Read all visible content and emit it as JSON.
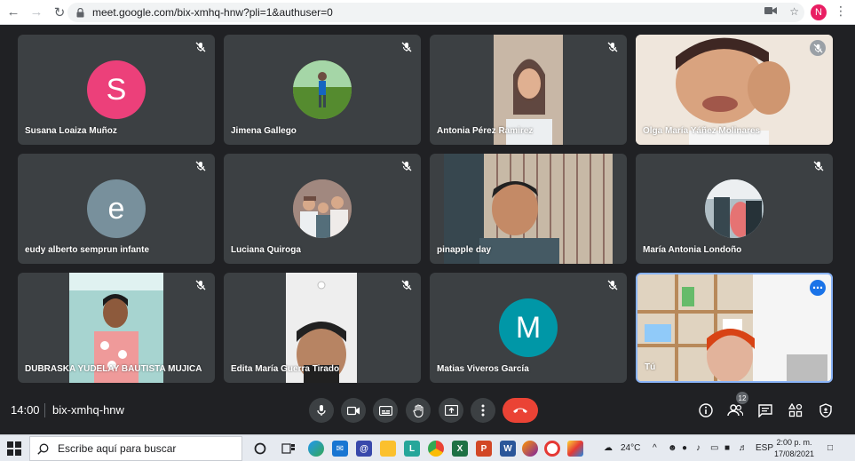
{
  "browser": {
    "url": "meet.google.com/bix-xmhq-hnw?pli=1&authuser=0",
    "profile_initial": "N"
  },
  "participants": [
    {
      "name": "Susana Loaiza Muñoz",
      "type": "initial",
      "initial": "S",
      "color": "#ec407a"
    },
    {
      "name": "Jimena Gallego",
      "type": "photo"
    },
    {
      "name": "Antonia Pérez Ramirez",
      "type": "video"
    },
    {
      "name": "Olga María Yáñez Molinares",
      "type": "video"
    },
    {
      "name": "eudy alberto semprun infante",
      "type": "initial",
      "initial": "e",
      "color": "#78909c"
    },
    {
      "name": "Luciana Quiroga",
      "type": "photo"
    },
    {
      "name": "pinapple day",
      "type": "video"
    },
    {
      "name": "María Antonia Londoño",
      "type": "photo"
    },
    {
      "name": "DUBRASKA YUDELAY BAUTISTA MUJICA",
      "type": "video"
    },
    {
      "name": "Edita María Guerra Tirado",
      "type": "video"
    },
    {
      "name": "Matias Viveros García",
      "type": "initial",
      "initial": "M",
      "color": "#0097a7"
    },
    {
      "name": "Tú",
      "type": "self"
    }
  ],
  "meeting": {
    "time": "14:00",
    "code": "bix-xmhq-hnw",
    "participant_count": "12"
  },
  "taskbar": {
    "search_placeholder": "Escribe aquí para buscar",
    "temperature": "24°C",
    "language": "ESP",
    "clock_time": "2:00 p. m.",
    "clock_date": "17/08/2021"
  }
}
